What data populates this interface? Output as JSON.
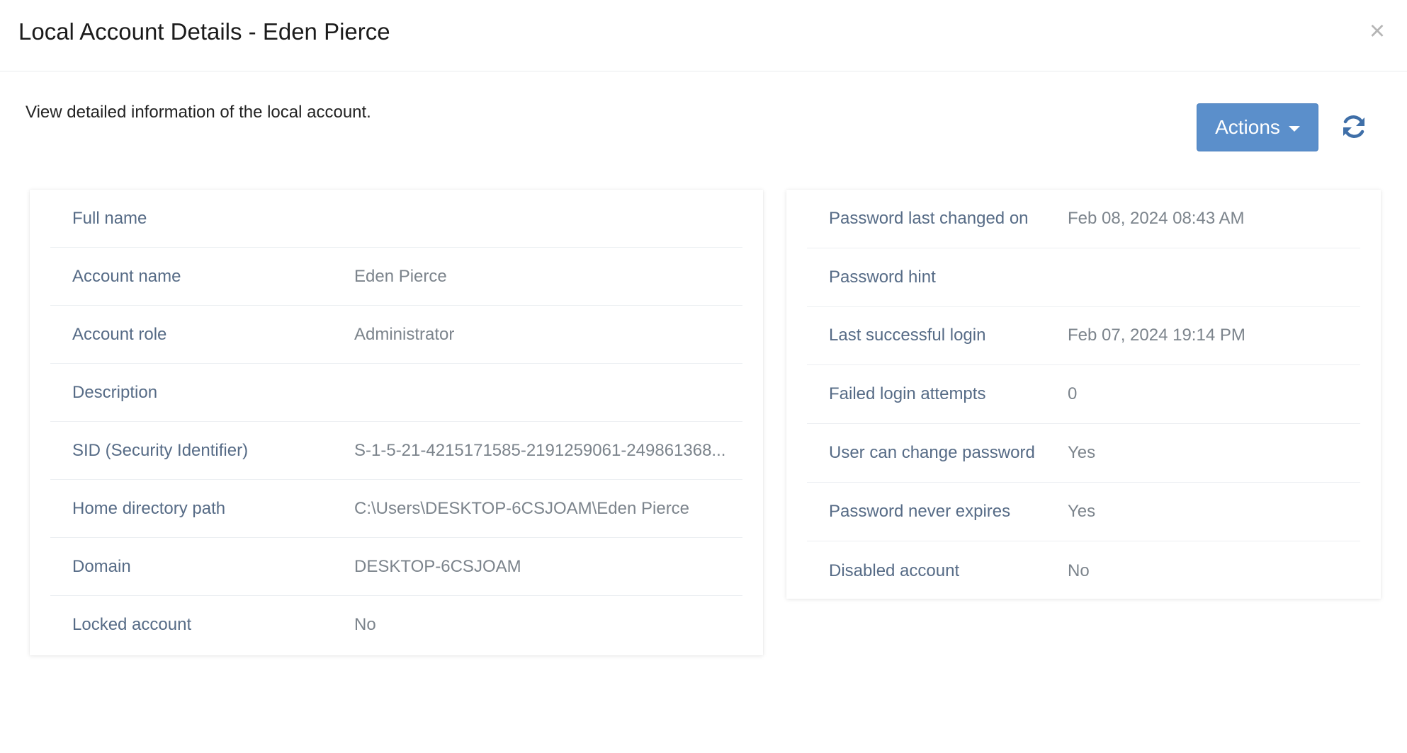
{
  "dialog": {
    "title": "Local Account Details - Eden Pierce",
    "close_icon": "close-icon",
    "subtitle": "View detailed information of the local account.",
    "actions_label": "Actions",
    "refresh_icon": "refresh-icon",
    "accent_color": "#5b8fcb"
  },
  "left_card": {
    "rows": [
      {
        "label": "Full name",
        "value": ""
      },
      {
        "label": "Account name",
        "value": "Eden Pierce"
      },
      {
        "label": "Account role",
        "value": "Administrator"
      },
      {
        "label": "Description",
        "value": ""
      },
      {
        "label": "SID (Security Identifier)",
        "value": "S-1-5-21-4215171585-2191259061-249861368..."
      },
      {
        "label": "Home directory path",
        "value": "C:\\Users\\DESKTOP-6CSJOAM\\Eden Pierce"
      },
      {
        "label": "Domain",
        "value": "DESKTOP-6CSJOAM"
      },
      {
        "label": "Locked account",
        "value": "No"
      }
    ]
  },
  "right_card": {
    "rows": [
      {
        "label": "Password last changed on",
        "value": "Feb 08, 2024 08:43 AM"
      },
      {
        "label": "Password hint",
        "value": ""
      },
      {
        "label": "Last successful login",
        "value": "Feb 07, 2024 19:14 PM"
      },
      {
        "label": "Failed login attempts",
        "value": "0"
      },
      {
        "label": "User can change password",
        "value": "Yes"
      },
      {
        "label": "Password never expires",
        "value": "Yes"
      },
      {
        "label": "Disabled account",
        "value": "No"
      }
    ]
  }
}
